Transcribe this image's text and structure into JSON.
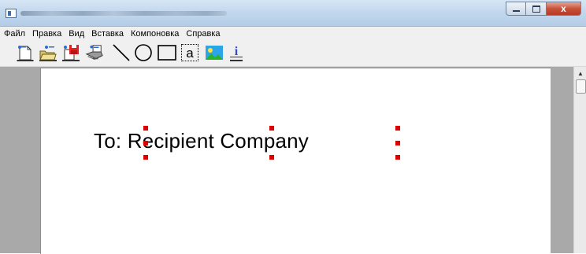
{
  "window": {
    "title": "",
    "controls": {
      "minimize_icon": "minimize-icon",
      "maximize_icon": "maximize-icon",
      "close_label": "x"
    }
  },
  "menu": [
    "Файл",
    "Правка",
    "Вид",
    "Вставка",
    "Компоновка",
    "Справка"
  ],
  "toolbar": {
    "tools": [
      "new-document-icon",
      "open-folder-icon",
      "save-disk-icon",
      "print-icon",
      "line-tool-icon",
      "ellipse-tool-icon",
      "rectangle-tool-icon",
      "text-tool-icon",
      "image-tool-icon",
      "properties-icon"
    ],
    "text_tool_glyph": "a",
    "properties_glyph": "i"
  },
  "document": {
    "text": "To: Recipient Company",
    "text_color": "#000000",
    "handle_color": "#e00000"
  },
  "scrollbar": {
    "up_glyph": "▲"
  }
}
